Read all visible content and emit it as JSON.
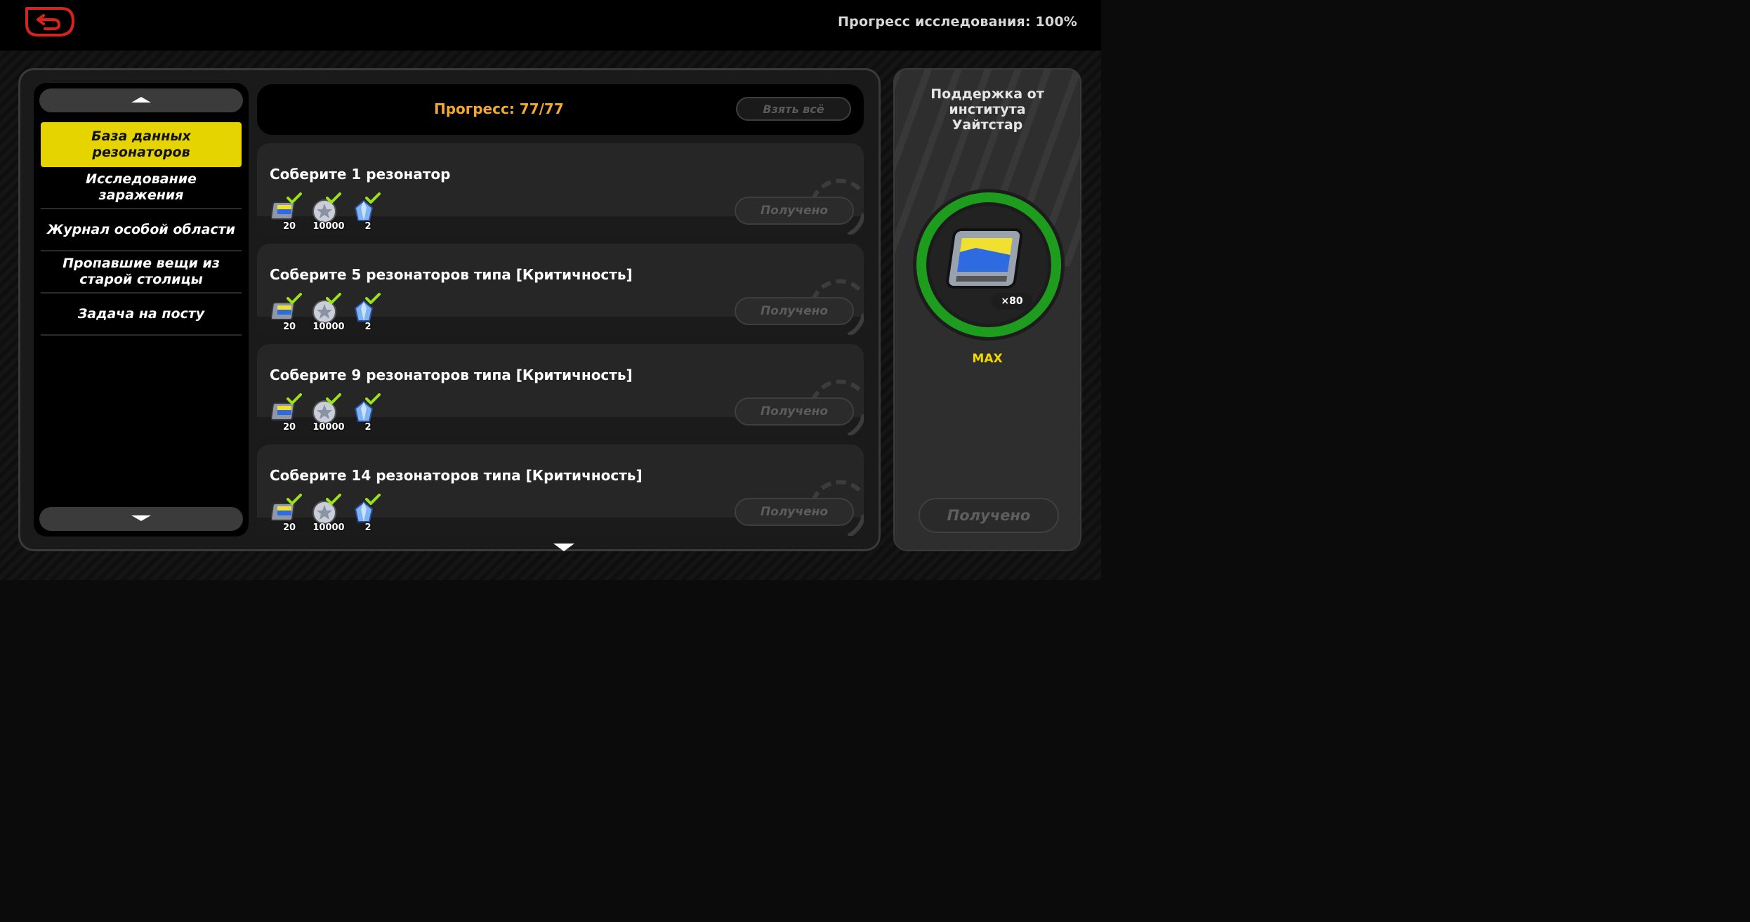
{
  "header": {
    "research_progress": "Прогресс исследования: 100%"
  },
  "nav": {
    "items": [
      {
        "label": "База данных резонаторов",
        "active": true
      },
      {
        "label": "Исследование заражения",
        "active": false
      },
      {
        "label": "Журнал особой области",
        "active": false
      },
      {
        "label": "Пропавшие вещи из старой столицы",
        "active": false
      },
      {
        "label": "Задача на посту",
        "active": false
      }
    ]
  },
  "main": {
    "progress": "Прогресс: 77/77",
    "take_all": "Взять всё",
    "tasks": [
      {
        "title": "Соберите 1 резонатор",
        "rewards": [
          "20",
          "10000",
          "2"
        ],
        "button": "Получено"
      },
      {
        "title": "Соберите 5 резонаторов типа [Критичность]",
        "rewards": [
          "20",
          "10000",
          "2"
        ],
        "button": "Получено"
      },
      {
        "title": "Соберите 9 резонаторов типа [Критичность]",
        "rewards": [
          "20",
          "10000",
          "2"
        ],
        "button": "Получено"
      },
      {
        "title": "Соберите 14 резонаторов типа [Критичность]",
        "rewards": [
          "20",
          "10000",
          "2"
        ],
        "button": "Получено"
      }
    ]
  },
  "side": {
    "title": "Поддержка от института Уайтстар",
    "reward_count": "×80",
    "level": "MAX",
    "button": "Получено",
    "ring_progress": 1.0
  },
  "colors": {
    "accent_yellow": "#e6d400",
    "progress_orange": "#f2a92e",
    "check_green": "#9be21a",
    "ring_green": "#1d9c1d",
    "back_red": "#d6231f"
  },
  "icons": {
    "reward_1": "film-reel-icon",
    "reward_2": "shell-credit-coin-icon",
    "reward_3": "crystal-icon",
    "back": "back-arrow-icon"
  }
}
